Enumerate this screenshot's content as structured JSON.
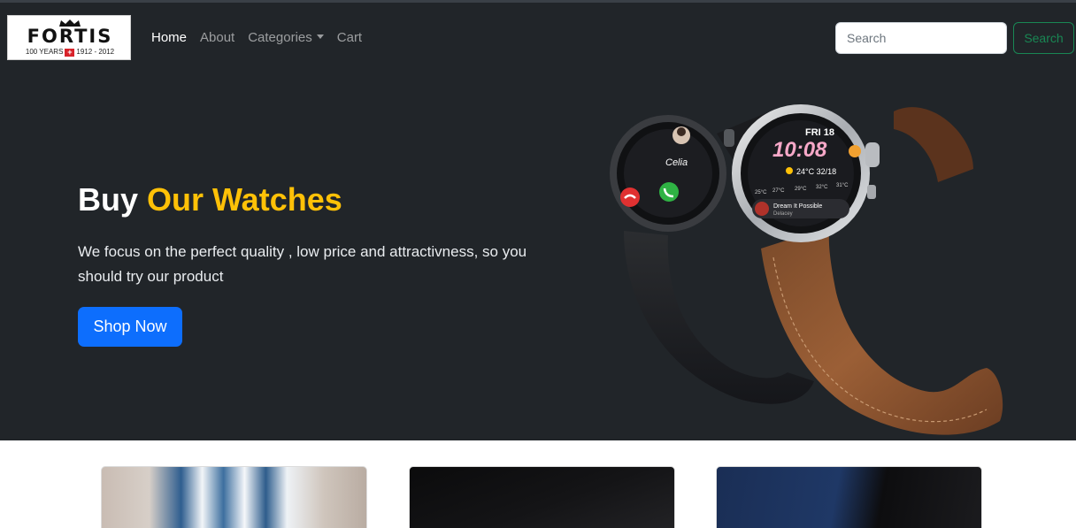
{
  "brand": {
    "wordmark": "FORTIS",
    "tagline_left": "100 YEARS",
    "tagline_right": "1912 - 2012"
  },
  "nav": {
    "items": [
      {
        "label": "Home",
        "active": true
      },
      {
        "label": "About",
        "active": false
      },
      {
        "label": "Categories",
        "active": false,
        "dropdown": true
      },
      {
        "label": "Cart",
        "active": false
      }
    ]
  },
  "search": {
    "placeholder": "Search",
    "button_label": "Search"
  },
  "hero": {
    "title_white": "Buy",
    "title_accent": "Our Watches",
    "text": "We focus on the perfect quality , low price and attractivness, so you should try our product",
    "button_label": "Shop Now"
  },
  "watch_screen": {
    "caller": "Celia",
    "day": "FRI 18",
    "time": "10:08",
    "weather": "24°C 32/18",
    "temps": [
      "25°C",
      "27°C",
      "29°C",
      "32°C",
      "31°C"
    ],
    "song": "Dream It Possible",
    "artist": "Delacey"
  },
  "colors": {
    "hero_bg": "#212529",
    "accent": "#ffc107",
    "primary": "#0d6efd",
    "success": "#198754"
  }
}
